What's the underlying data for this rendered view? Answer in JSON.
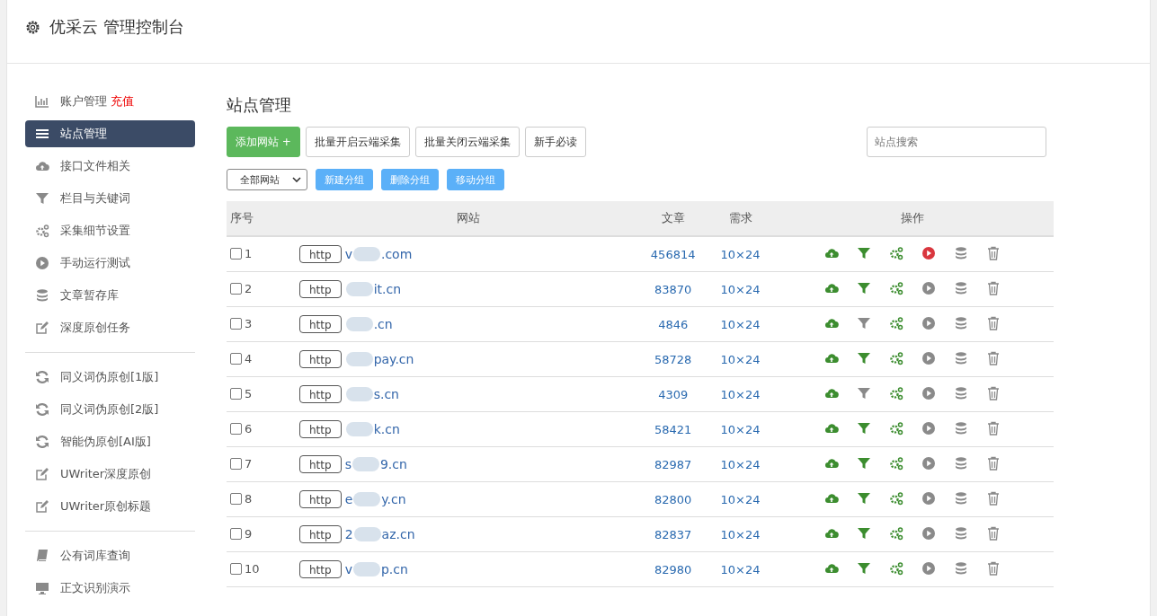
{
  "header": {
    "title": "优采云 管理控制台"
  },
  "sidebar": {
    "groups": [
      [
        {
          "label": "账户管理",
          "extra": "充值",
          "selected": false
        },
        {
          "label": "站点管理",
          "selected": true
        },
        {
          "label": "接口文件相关",
          "selected": false
        },
        {
          "label": "栏目与关键词",
          "selected": false
        },
        {
          "label": "采集细节设置",
          "selected": false
        },
        {
          "label": "手动运行测试",
          "selected": false
        },
        {
          "label": "文章暂存库",
          "selected": false
        },
        {
          "label": "深度原创任务",
          "selected": false
        }
      ],
      [
        {
          "label": "同义词伪原创[1版]",
          "selected": false
        },
        {
          "label": "同义词伪原创[2版]",
          "selected": false
        },
        {
          "label": "智能伪原创[AI版]",
          "selected": false
        },
        {
          "label": "UWriter深度原创",
          "selected": false
        },
        {
          "label": "UWriter原创标题",
          "selected": false
        }
      ],
      [
        {
          "label": "公有词库查询",
          "selected": false
        },
        {
          "label": "正文识别演示",
          "selected": false
        }
      ]
    ]
  },
  "main": {
    "title": "站点管理",
    "add_button": "添加网站 +",
    "buttons": [
      "批量开启云端采集",
      "批量关闭云端采集",
      "新手必读"
    ],
    "search": {
      "placeholder": "站点搜索"
    },
    "group_select": "全部网站",
    "group_buttons": [
      "新建分组",
      "删除分组",
      "移动分组"
    ],
    "table": {
      "columns": [
        "序号",
        "网站",
        "文章",
        "需求",
        "操作"
      ],
      "rows": [
        {
          "no": "1",
          "checked": false,
          "scheme": "http",
          "prefix": "v",
          "suffix": ".com",
          "articles": "456814",
          "demand": "10×24",
          "filter_on": true,
          "running": true
        },
        {
          "no": "2",
          "checked": false,
          "scheme": "http",
          "prefix": "",
          "suffix": "it.cn",
          "articles": "83870",
          "demand": "10×24",
          "filter_on": true,
          "running": false
        },
        {
          "no": "3",
          "checked": false,
          "scheme": "http",
          "prefix": "",
          "suffix": ".cn",
          "articles": "4846",
          "demand": "10×24",
          "filter_on": false,
          "running": false
        },
        {
          "no": "4",
          "checked": false,
          "scheme": "http",
          "prefix": "",
          "suffix": "pay.cn",
          "articles": "58728",
          "demand": "10×24",
          "filter_on": true,
          "running": false
        },
        {
          "no": "5",
          "checked": false,
          "scheme": "http",
          "prefix": "",
          "suffix": "s.cn",
          "articles": "4309",
          "demand": "10×24",
          "filter_on": false,
          "running": false
        },
        {
          "no": "6",
          "checked": false,
          "scheme": "http",
          "prefix": "",
          "suffix": "k.cn",
          "articles": "58421",
          "demand": "10×24",
          "filter_on": true,
          "running": false
        },
        {
          "no": "7",
          "checked": false,
          "scheme": "http",
          "prefix": "s",
          "suffix": "9.cn",
          "articles": "82987",
          "demand": "10×24",
          "filter_on": true,
          "running": false
        },
        {
          "no": "8",
          "checked": false,
          "scheme": "http",
          "prefix": "e",
          "suffix": "y.cn",
          "articles": "82800",
          "demand": "10×24",
          "filter_on": true,
          "running": false
        },
        {
          "no": "9",
          "checked": false,
          "scheme": "http",
          "prefix": "2",
          "suffix": "az.cn",
          "articles": "82837",
          "demand": "10×24",
          "filter_on": true,
          "running": false
        },
        {
          "no": "10",
          "checked": false,
          "scheme": "http",
          "prefix": "v",
          "suffix": "p.cn",
          "articles": "82980",
          "demand": "10×24",
          "filter_on": true,
          "running": false
        }
      ]
    }
  }
}
